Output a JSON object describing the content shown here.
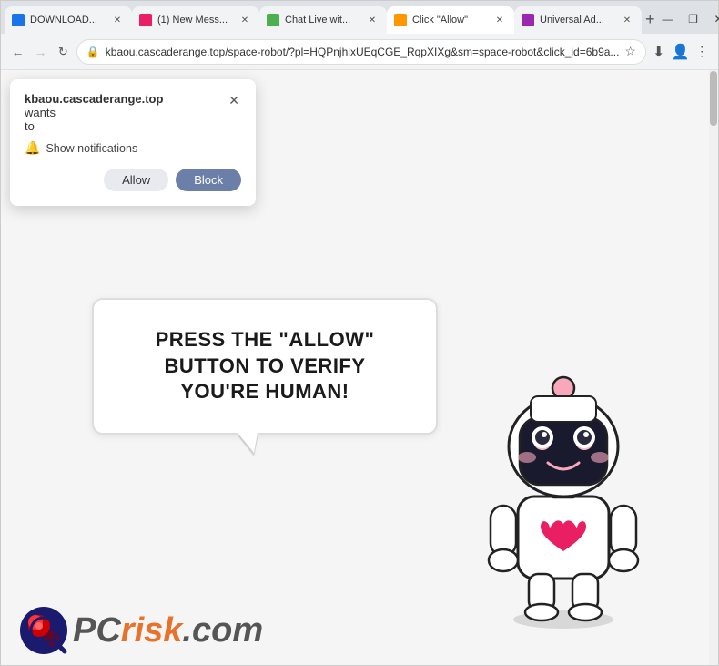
{
  "browser": {
    "tabs": [
      {
        "id": "tab1",
        "favicon_color": "#1a73e8",
        "label": "DOWNLOAD...",
        "active": false
      },
      {
        "id": "tab2",
        "favicon_color": "#e91e63",
        "label": "(1) New Mess...",
        "active": false
      },
      {
        "id": "tab3",
        "favicon_color": "#4caf50",
        "label": "Chat Live wit...",
        "active": false
      },
      {
        "id": "tab4",
        "favicon_color": "#ff9800",
        "label": "Click \"Allow\"",
        "active": true
      },
      {
        "id": "tab5",
        "favicon_color": "#9c27b0",
        "label": "Universal Ad...",
        "active": false
      }
    ],
    "new_tab_icon": "+",
    "window_controls": [
      "—",
      "❒",
      "✕"
    ],
    "address": "kbaou.cascaderange.top/space-robot/?pl=HQPnjhlxUEqCGE_RqpXIXg&sm=space-robot&click_id=6b9a...",
    "back_icon": "←",
    "forward_icon": "→",
    "reload_icon": "↻",
    "menu_icon": "⋮"
  },
  "notification_popup": {
    "site": "kbaou.cascaderange.top",
    "wants_text": "wants",
    "to_text": "to",
    "show_notifications_label": "Show notifications",
    "allow_label": "Allow",
    "block_label": "Block",
    "close_icon": "✕"
  },
  "page": {
    "bubble_text_line1": "PRESS THE \"ALLOW\" BUTTON TO VERIFY",
    "bubble_text_line2": "YOU'RE HUMAN!",
    "pcrisk_pc": "PC",
    "pcrisk_risk": "risk",
    "pcrisk_dotcom": ".com"
  }
}
